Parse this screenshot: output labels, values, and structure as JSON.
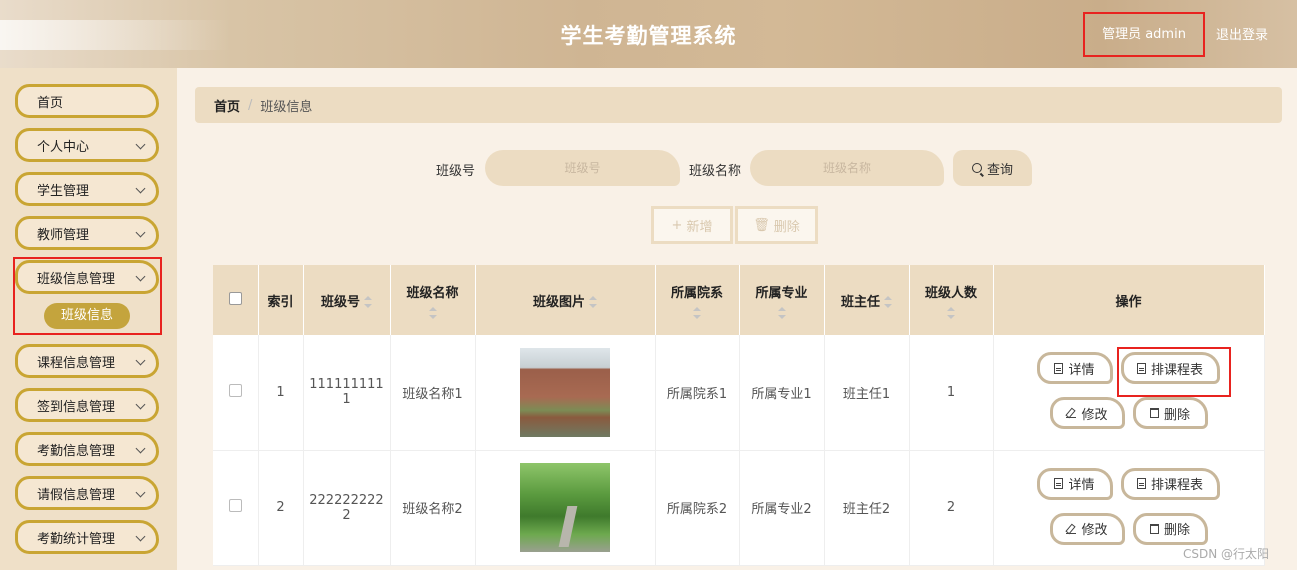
{
  "header": {
    "title": "学生考勤管理系统",
    "user": "管理员 admin",
    "logout": "退出登录"
  },
  "sidebar": {
    "items": [
      {
        "label": "首页",
        "has_chevron": false
      },
      {
        "label": "个人中心",
        "has_chevron": true
      },
      {
        "label": "学生管理",
        "has_chevron": true
      },
      {
        "label": "教师管理",
        "has_chevron": true
      },
      {
        "label": "班级信息管理",
        "has_chevron": true
      },
      {
        "label": "课程信息管理",
        "has_chevron": true
      },
      {
        "label": "签到信息管理",
        "has_chevron": true
      },
      {
        "label": "考勤信息管理",
        "has_chevron": true
      },
      {
        "label": "请假信息管理",
        "has_chevron": true
      },
      {
        "label": "考勤统计管理",
        "has_chevron": true
      }
    ],
    "active_sub": "班级信息"
  },
  "breadcrumb": {
    "home": "首页",
    "sep": "/",
    "current": "班级信息"
  },
  "search": {
    "class_no_label": "班级号",
    "class_no_placeholder": "班级号",
    "class_name_label": "班级名称",
    "class_name_placeholder": "班级名称",
    "query_button": "查询"
  },
  "toolbar": {
    "add": "新增",
    "delete": "删除"
  },
  "table": {
    "headers": [
      "索引",
      "班级号",
      "班级名称",
      "班级图片",
      "所属院系",
      "所属专业",
      "班主任",
      "班级人数",
      "操作"
    ],
    "rows": [
      {
        "index": "1",
        "class_no_l1": "111111111",
        "class_no_l2": "1",
        "class_name": "班级名称1",
        "dept": "所属院系1",
        "major": "所属专业1",
        "teacher": "班主任1",
        "count": "1"
      },
      {
        "index": "2",
        "class_no_l1": "222222222",
        "class_no_l2": "2",
        "class_name": "班级名称2",
        "dept": "所属院系2",
        "major": "所属专业2",
        "teacher": "班主任2",
        "count": "2"
      }
    ],
    "ops": {
      "detail": "详情",
      "schedule": "排课程表",
      "edit": "修改",
      "delete": "删除"
    }
  },
  "watermark": "CSDN @行太阳",
  "colors": {
    "accent_gold": "#c9a533",
    "highlight_red": "#e8231f",
    "panel_beige": "#ecdcc2"
  }
}
